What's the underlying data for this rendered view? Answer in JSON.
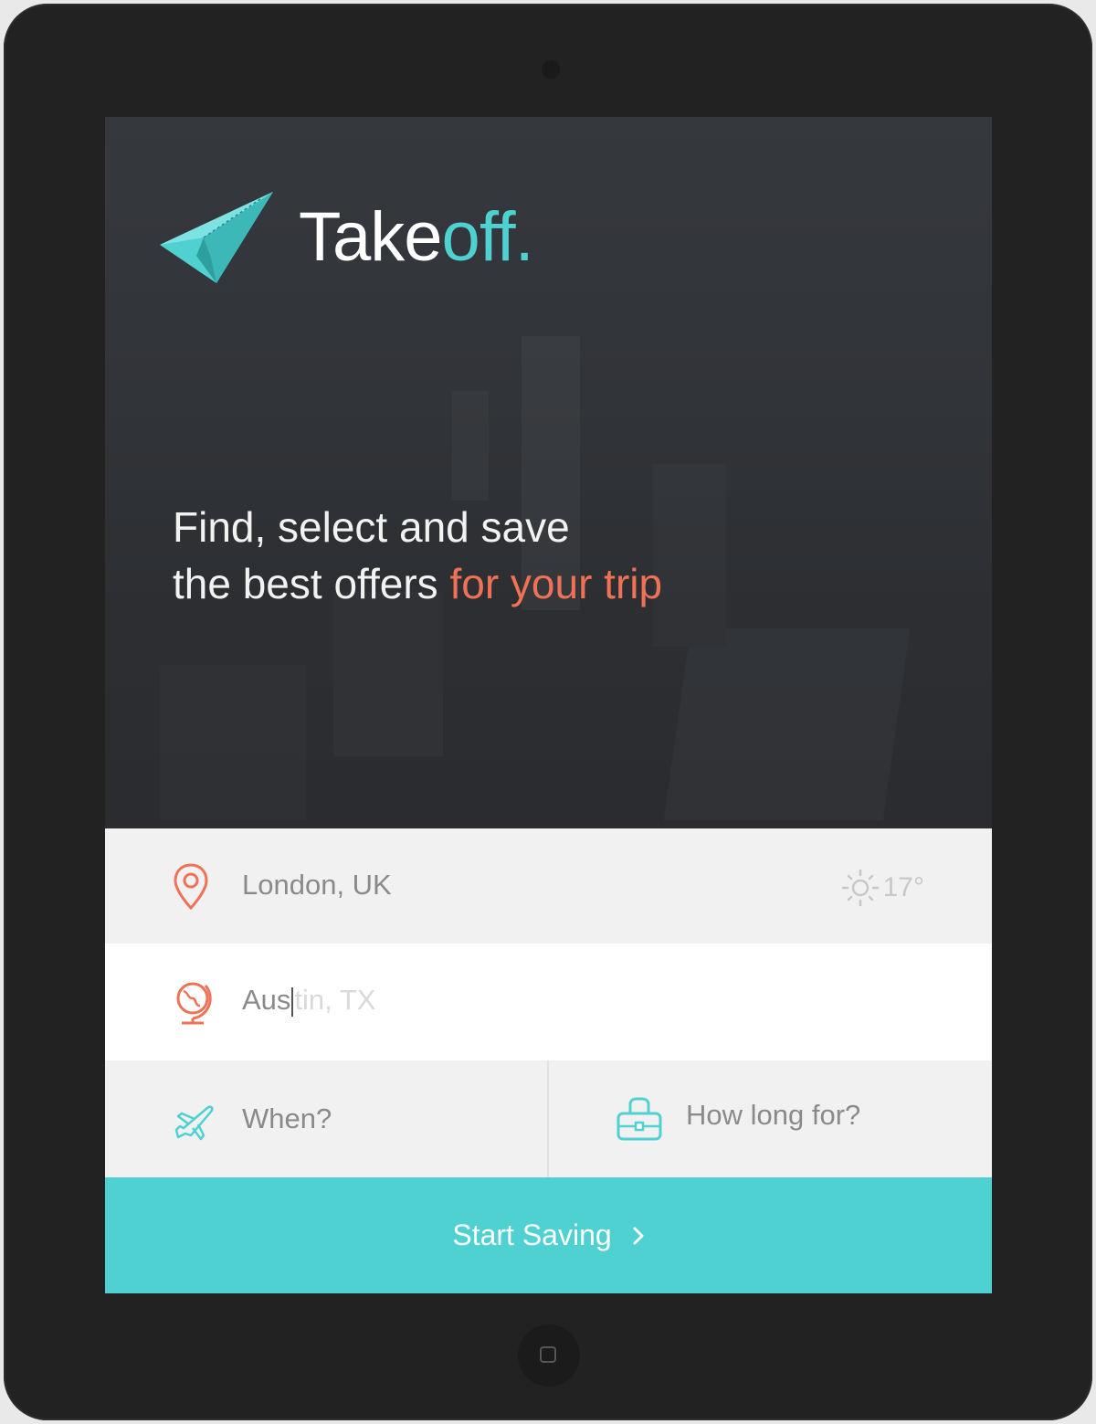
{
  "brand": {
    "name_main": "Take",
    "name_accent": "off."
  },
  "hero": {
    "line1": "Find, select and save",
    "line2_plain": "the best offers ",
    "line2_highlight": "for your trip"
  },
  "origin": {
    "value": "London, UK",
    "weather": "17°",
    "icon": "location-pin-icon",
    "weather_icon": "sun-icon"
  },
  "destination": {
    "typed": "Aus",
    "suggestion": "tin, TX",
    "icon": "globe-icon"
  },
  "when": {
    "placeholder": "When?",
    "icon": "airplane-icon"
  },
  "duration": {
    "placeholder": "How long for?",
    "icon": "suitcase-icon"
  },
  "cta": {
    "label": "Start Saving"
  },
  "colors": {
    "accent": "#4fd1d2",
    "highlight": "#ef7156",
    "hero_bg": "#313438"
  }
}
